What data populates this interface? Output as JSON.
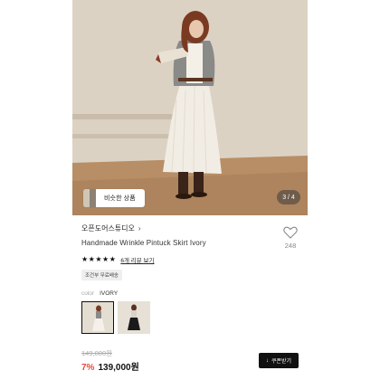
{
  "hero": {
    "image_desc": "model-photo",
    "similar_button_label": "비슷한 상품",
    "page_indicator": "3 / 4"
  },
  "product": {
    "brand": "오픈도어스튜디오",
    "brand_chevron": "›",
    "name": "Handmade Wrinkle Pintuck Skirt Ivory",
    "wishlist_count": "248",
    "rating_stars": 5,
    "star_glyph": "★",
    "review_link": "6개 리뷰 보기",
    "badge": "조건부 무료배송",
    "color_key": "color",
    "color_value": "IVORY",
    "original_price": "149,000원",
    "discount": "7%",
    "price": "139,000원",
    "coupon_label": "쿠폰받기",
    "coupon_icon": "↓"
  },
  "colors": {
    "accent_red": "#e54b3c",
    "button_black": "#111111"
  }
}
